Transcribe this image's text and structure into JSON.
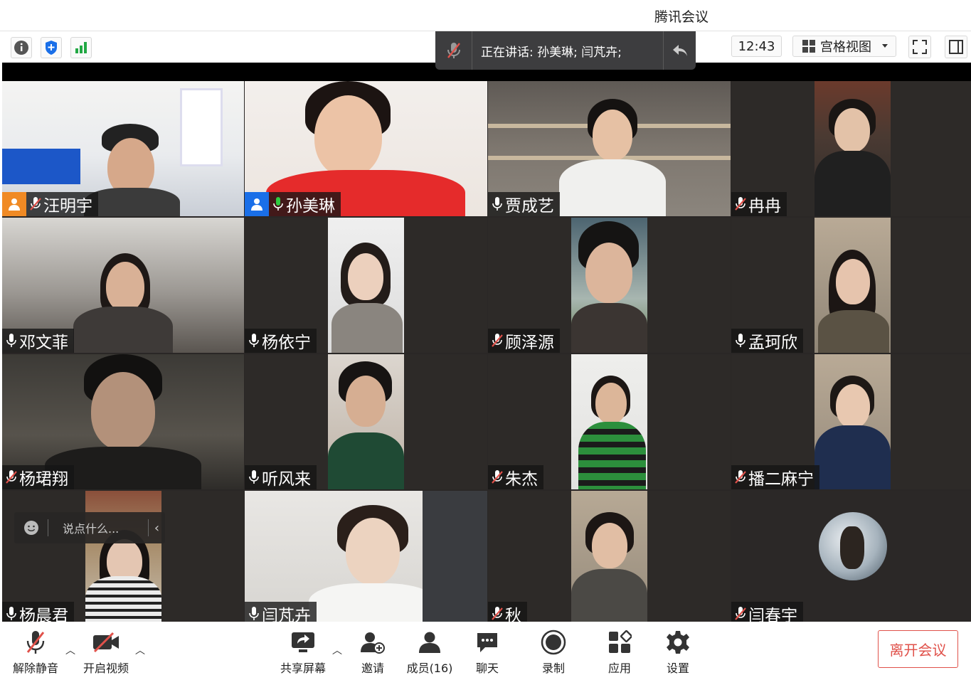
{
  "window": {
    "title": "腾讯会议"
  },
  "toolbar": {
    "time": "12:43",
    "view_label": "宫格视图"
  },
  "speaking": {
    "text": "正在讲话: 孙美琳; 闫芃卉;"
  },
  "participants": [
    {
      "name": "汪明宇",
      "mic": "muted",
      "role": "host"
    },
    {
      "name": "孙美琳",
      "mic": "on",
      "role": "cohost"
    },
    {
      "name": "贾成艺",
      "mic": "on"
    },
    {
      "name": "冉冉",
      "mic": "muted"
    },
    {
      "name": "邓文菲",
      "mic": "on"
    },
    {
      "name": "杨依宁",
      "mic": "on"
    },
    {
      "name": "顾泽源",
      "mic": "muted"
    },
    {
      "name": "孟珂欣",
      "mic": "on"
    },
    {
      "name": "杨珺翔",
      "mic": "muted"
    },
    {
      "name": "听风来",
      "mic": "on"
    },
    {
      "name": "朱杰",
      "mic": "muted"
    },
    {
      "name": "播二麻宁",
      "mic": "muted"
    },
    {
      "name": "杨晨君",
      "mic": "on"
    },
    {
      "name": "闫芃卉",
      "mic": "on"
    },
    {
      "name": "秋",
      "mic": "muted"
    },
    {
      "name": "闫春宇",
      "mic": "muted",
      "video": "off"
    }
  ],
  "chat_input": {
    "placeholder": "说点什么..."
  },
  "bottom": {
    "unmute": "解除静音",
    "start_video": "开启视频",
    "share": "共享屏幕",
    "invite": "邀请",
    "members": "成员(16)",
    "chat": "聊天",
    "record": "录制",
    "apps": "应用",
    "settings": "设置",
    "leave": "离开会议"
  },
  "colors": {
    "accent_green": "#1fb86a",
    "host_orange": "#f08a24",
    "cohost_blue": "#1a6fe8",
    "muted_red": "#e0514a",
    "leave_red": "#e0514a"
  }
}
